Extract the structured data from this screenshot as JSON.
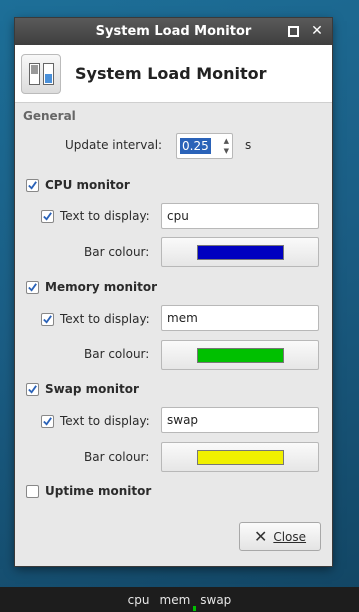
{
  "window": {
    "title": "System Load Monitor"
  },
  "header": {
    "title": "System Load Monitor",
    "icon": "system-load-monitor-icon"
  },
  "general": {
    "section_title": "General",
    "update_interval_label": "Update interval:",
    "update_interval_value": "0.25",
    "update_interval_unit": "s"
  },
  "cpu": {
    "label": "CPU monitor",
    "checked": true,
    "text_label": "Text to display:",
    "text_checked": true,
    "text_value": "cpu",
    "bar_label": "Bar colour:",
    "bar_color": "#0000c0"
  },
  "memory": {
    "label": "Memory monitor",
    "checked": true,
    "text_label": "Text to display:",
    "text_checked": true,
    "text_value": "mem",
    "bar_label": "Bar colour:",
    "bar_color": "#00c000"
  },
  "swap": {
    "label": "Swap monitor",
    "checked": true,
    "text_label": "Text to display:",
    "text_checked": true,
    "text_value": "swap",
    "bar_label": "Bar colour:",
    "bar_color": "#f0f000"
  },
  "uptime": {
    "label": "Uptime monitor",
    "checked": false
  },
  "buttons": {
    "close_label": "Close"
  },
  "panel": {
    "items": [
      "cpu",
      "mem",
      "swap"
    ]
  }
}
